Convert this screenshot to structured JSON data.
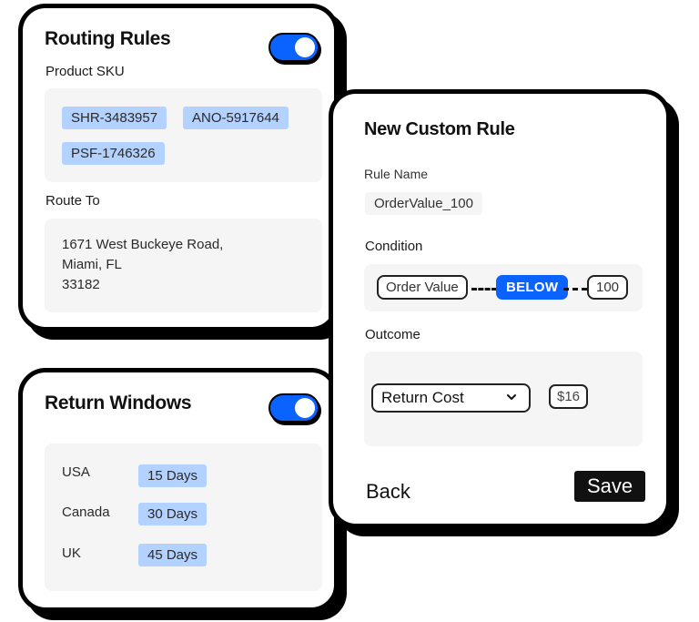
{
  "routing_rules": {
    "title": "Routing Rules",
    "enabled": true,
    "product_sku_label": "Product SKU",
    "skus": [
      "SHR-3483957",
      "ANO-5917644",
      "PSF-1746326"
    ],
    "route_to_label": "Route To",
    "address": {
      "line1": "1671 West Buckeye Road,",
      "line2": "Miami, FL",
      "line3": "33182"
    }
  },
  "return_windows": {
    "title": "Return Windows",
    "enabled": true,
    "rows": [
      {
        "country": "USA",
        "window": "15 Days"
      },
      {
        "country": "Canada",
        "window": "30 Days"
      },
      {
        "country": "UK",
        "window": "45 Days"
      }
    ]
  },
  "custom_rule": {
    "title": "New Custom Rule",
    "rule_name_label": "Rule Name",
    "rule_name_value": "OrderValue_100",
    "condition_label": "Condition",
    "condition": {
      "field": "Order Value",
      "operator": "BELOW",
      "value": "100"
    },
    "outcome_label": "Outcome",
    "outcome": {
      "selected": "Return Cost",
      "value": "$16"
    },
    "back_label": "Back",
    "save_label": "Save"
  },
  "colors": {
    "accent": "#0a62ff",
    "chip_bg": "#b4d2ff",
    "panel_bg": "#f5f5f5",
    "border": "#000000"
  }
}
